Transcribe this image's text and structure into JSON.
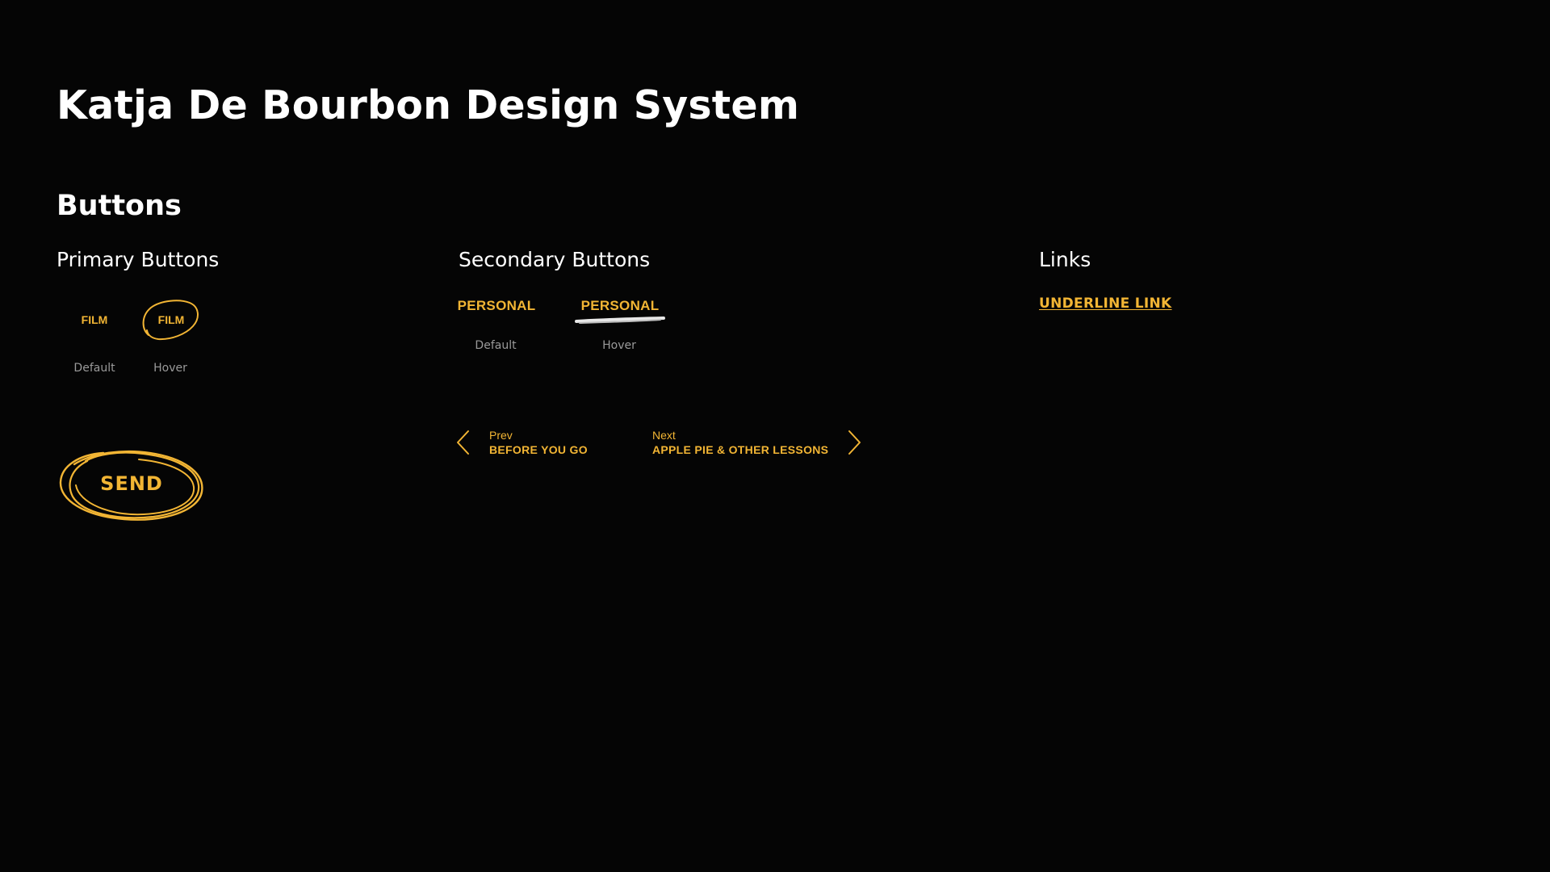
{
  "page": {
    "title": "Katja De Bourbon Design System"
  },
  "sections": {
    "buttons": {
      "title": "Buttons"
    }
  },
  "primary": {
    "title": "Primary Buttons",
    "default_label": "FILM",
    "hover_label": "FILM",
    "state_default": "Default",
    "state_hover": "Hover",
    "send_label": "SEND"
  },
  "secondary": {
    "title": "Secondary Buttons",
    "default_label": "PERSONAL",
    "hover_label": "PERSONAL",
    "state_default": "Default",
    "state_hover": "Hover"
  },
  "links": {
    "title": "Links",
    "underline_link": "UNDERLINE LINK"
  },
  "pagination": {
    "prev": {
      "small": "Prev",
      "title": "BEFORE YOU GO"
    },
    "next": {
      "small": "Next",
      "title": "APPLE PIE & OTHER LESSONS"
    }
  },
  "colors": {
    "background": "#050505",
    "accent": "#f2b534",
    "text": "#ffffff",
    "muted": "#9a9a9a"
  },
  "icons": {
    "prev": "chevron-left-icon",
    "next": "chevron-right-icon",
    "hover_outline": "scribble-circle-icon",
    "hover_underline": "brush-underline-icon"
  }
}
